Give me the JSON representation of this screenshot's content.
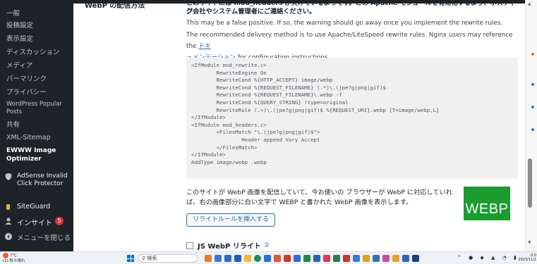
{
  "sidebar": {
    "items": [
      {
        "label": "一般"
      },
      {
        "label": "投稿設定"
      },
      {
        "label": "表示設定"
      },
      {
        "label": "ディスカッション"
      },
      {
        "label": "メディア"
      },
      {
        "label": "パーマリンク"
      },
      {
        "label": "プライバシー"
      },
      {
        "label": "WordPress Popular Posts"
      },
      {
        "label": "共有"
      },
      {
        "label": "XML-Sitemap"
      },
      {
        "label": "EWWW Image Optimizer"
      }
    ],
    "plugins": [
      {
        "label": "AdSense Invalid Click Protector",
        "icon": "shield-icon"
      },
      {
        "label": "SiteGuard",
        "icon": "siteguard-icon"
      },
      {
        "label": "インサイト",
        "icon": "insights-icon",
        "badge": "5"
      },
      {
        "label": "メニューを閉じる",
        "icon": "collapse-menu-icon"
      }
    ]
  },
  "main": {
    "row_label": "WebP の配信方法",
    "warning_jp_line1": "このサイトには mod_headers が欠けているようです。この Apache モジュールを有効化するよう、ホスティン",
    "warning_jp_line2": "グ会社やシステム管理者にご連絡ください。",
    "false_positive": "This may be a false positive. If so, the warning should go away once you implement the rewrite rules.",
    "delivery_prefix": "The recommended delivery method is to use Apache/LiteSpeed rewrite rules. Nginx users may reference the",
    "delivery_link_part1": "ドキ",
    "delivery_link_part2": "ュメンテーション",
    "delivery_suffix": " for configuration instructions.",
    "code": "<IfModule mod_rewrite.c>\n        RewriteEngine On\n        RewriteCond %{HTTP_ACCEPT} image/webp\n        RewriteCond %{REQUEST_FILENAME} (.*)\\.(jpe?g|png|gif)$\n        RewriteCond %{REQUEST_FILENAME}\\.webp -f\n        RewriteCond %{QUERY_STRING} !type=original\n        RewriteRule (.+)\\.(jpe?g|png|gif)$ %{REQUEST_URI}.webp [T=image/webp,L]\n</IfModule>\n<IfModule mod_headers.c>\n        <FilesMatch \"\\.(jpe?g|png|gif)$\">\n                Header append Vary Accept\n        </FilesMatch>\n</IfModule>\nAddType image/webp .webp",
    "webp_description": "このサイトが WebP 画像を配信していて、今お使いの ブラウザーが WebP に対応していれば、右の画像部分に白い文字で WEBP と書かれた WebP 画像を表示します。",
    "webp_logo_text": "WEBP",
    "insert_rules_button": "リライトルールを挿入する",
    "js_webp_label": "JS WebP リライト",
    "help_icon": "②"
  },
  "taskbar": {
    "weather_temp": "7℃",
    "weather_desc": "(1) 所々晴れ",
    "search_placeholder": "検索",
    "clock_time": "0:0",
    "clock_date": "2023/11/1"
  },
  "colors": {
    "sidebar_bg": "#1d2327",
    "link": "#2271b1",
    "webp_green": "#1a9c2f",
    "badge_red": "#d63638"
  }
}
